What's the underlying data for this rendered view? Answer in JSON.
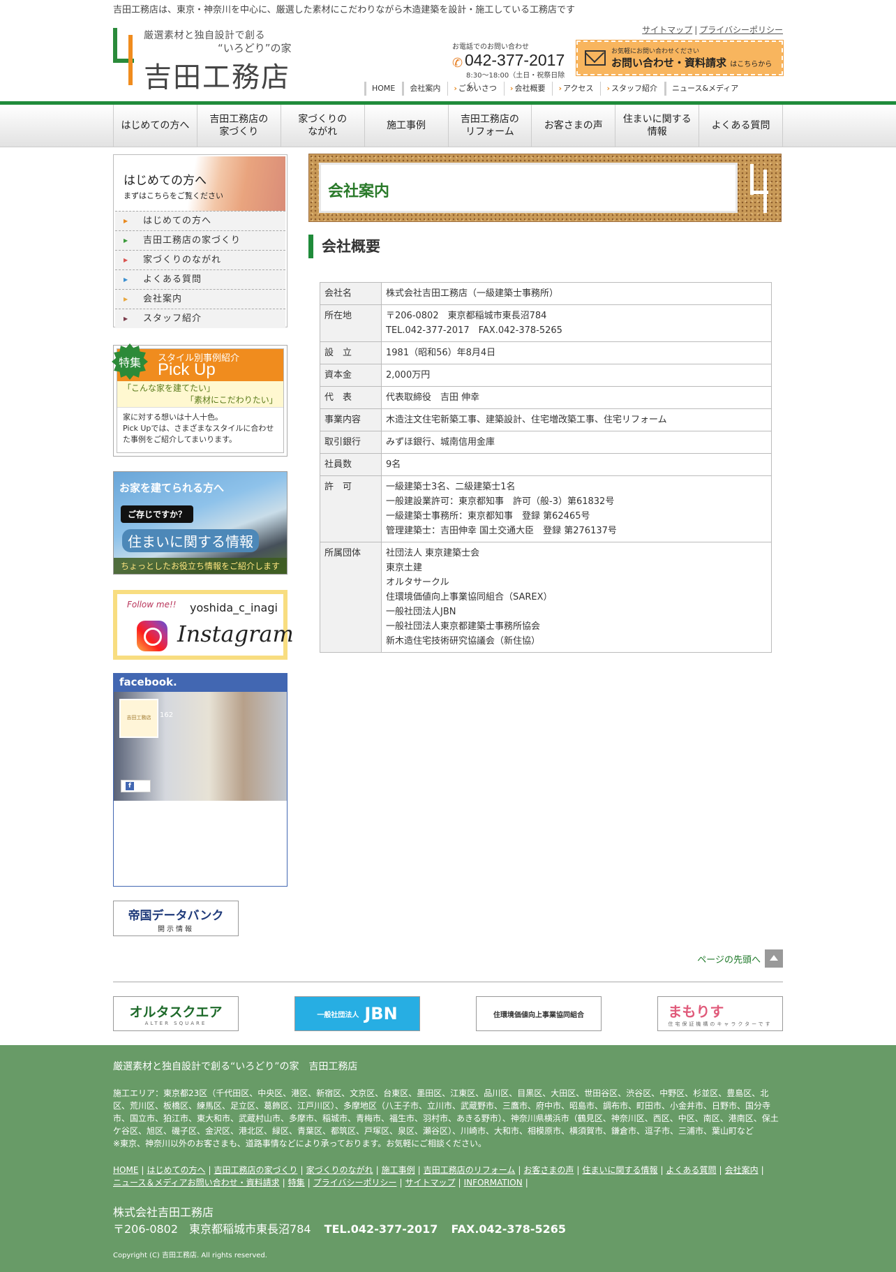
{
  "tagline": "吉田工務店は、東京・神奈川を中心に、厳選した素材にこだわりながら木造建築を設計・施工している工務店です",
  "logo": {
    "sub1": "厳選素材と独自設計で創る",
    "sub2": "“いろどり”の家",
    "name": "吉田工務店"
  },
  "toplinks": [
    "サイトマップ",
    "プライバシーポリシー"
  ],
  "phone": {
    "caption": "お電話でのお問い合わせ",
    "number": "042-377-2017",
    "hours": "8:30〜18:00（土日・祝祭日除く）"
  },
  "contact": {
    "small": "お気軽にお問い合わせください",
    "big": "お問い合わせ・資料請求",
    "suffix": "はこちらから"
  },
  "subnav": [
    "HOME",
    "会社案内",
    "ごあいさつ",
    "会社概要",
    "アクセス",
    "スタッフ紹介",
    "ニュース&メディア"
  ],
  "gnav": [
    "はじめての方へ",
    "吉田工務店の\n家づくり",
    "家づくりの\nながれ",
    "施工事例",
    "吉田工務店の\nリフォーム",
    "お客さまの声",
    "住まいに関する\n情報",
    "よくある質問"
  ],
  "sidebar": {
    "head_title": "はじめての方へ",
    "head_sub": "まずはこちらをご覧ください",
    "items": [
      "はじめての方へ",
      "吉田工務店の家づくり",
      "家づくりのながれ",
      "よくある質問",
      "会社案内",
      "スタッフ紹介"
    ]
  },
  "pickup": {
    "badge": "特集",
    "sub": "スタイル別事例紹介",
    "main": "Pick Up",
    "q1": "「こんな家を建てたい」",
    "q2": "「素材にこだわりたい」",
    "text": "家に対する想いは十人十色。\nPick Upでは、さまざまなスタイルに合わせた事例をご紹介してまいります。"
  },
  "house_banner": {
    "t1": "お家を建てられる方へ",
    "t2": "ご存じですか？",
    "t3": "住まいに関する情報",
    "t4": "ちょっとしたお役立ち情報をご紹介します"
  },
  "instagram": {
    "follow": "Follow me!!",
    "user": "yoshida_c_inagi",
    "word": "Instagram"
  },
  "facebook": {
    "head": "facebook.",
    "thumb": "吉田工務店",
    "count": "162"
  },
  "tdb": {
    "t1": "帝国データバンク",
    "t2": "開示情報"
  },
  "page_title": "会社案内",
  "section_title": "会社概要",
  "company_table": [
    {
      "key": "会社名",
      "lines": [
        "株式会社吉田工務店（一級建築士事務所）"
      ]
    },
    {
      "key": "所在地",
      "lines": [
        "〒206-0802　東京都稲城市東長沼784",
        "TEL.042-377-2017　FAX.042-378-5265"
      ]
    },
    {
      "key": "設　立",
      "lines": [
        "1981（昭和56）年8月4日"
      ]
    },
    {
      "key": "資本金",
      "lines": [
        "2,000万円"
      ]
    },
    {
      "key": "代　表",
      "lines": [
        "代表取締役　吉田 伸幸"
      ]
    },
    {
      "key": "事業内容",
      "lines": [
        "木造注文住宅新築工事、建築設計、住宅増改築工事、住宅リフォーム"
      ]
    },
    {
      "key": "取引銀行",
      "lines": [
        "みずほ銀行、城南信用金庫"
      ]
    },
    {
      "key": "社員数",
      "lines": [
        "9名"
      ]
    },
    {
      "key": "許　可",
      "lines": [
        "一級建築士3名、二級建築士1名",
        "一般建設業許可：東京都知事　許可（般-3）第61832号",
        "一級建築士事務所：東京都知事　登録 第62465号",
        "管理建築士：吉田伸幸 国土交通大臣　登録 第276137号"
      ]
    },
    {
      "key": "所属団体",
      "lines": [
        "社団法人 東京建築士会",
        "東京土建",
        "オルタサークル",
        "住環境価値向上事業協同組合（SAREX）",
        "一般社団法人JBN",
        "一般社団法人東京都建築士事務所協会",
        "新木造住宅技術研究協議会（新住協）"
      ]
    }
  ],
  "pagetop": "ページの先頭へ",
  "partners": {
    "alter": "オルタスクエア",
    "alter_sub": "ALTER SQUARE",
    "jbn_small": "一般社団法人",
    "jbn": "JBN",
    "sarex": "住環境価値向上事業協同組合",
    "mamoris": "まもりす",
    "mamoris_sub": "住宅保証機構のキャラクターです"
  },
  "footer": {
    "title": "厳選素材と独自設計で創る“いろどり”の家　吉田工務店",
    "area": "施工エリア：東京都23区（千代田区、中央区、港区、新宿区、文京区、台東区、墨田区、江東区、品川区、目黒区、大田区、世田谷区、渋谷区、中野区、杉並区、豊島区、北区、荒川区、板橋区、練馬区、足立区、葛飾区、江戸川区）、多摩地区（八王子市、立川市、武蔵野市、三鷹市、府中市、昭島市、調布市、町田市、小金井市、日野市、国分寺市、国立市、狛江市、東大和市、武蔵村山市、多摩市、稲城市、青梅市、福生市、羽村市、あきる野市）、神奈川県横浜市（鶴見区、神奈川区、西区、中区、南区、港南区、保土ケ谷区、旭区、磯子区、金沢区、港北区、緑区、青葉区、都筑区、戸塚区、泉区、瀬谷区）、川崎市、大和市、相模原市、横須賀市、鎌倉市、逗子市、三浦市、葉山町など",
    "note": "※東京、神奈川以外のお客さまも、道路事情などにより承っております。お気軽にご相談ください。",
    "links": [
      "HOME",
      "はじめての方へ",
      "吉田工務店の家づくり",
      "家づくりのながれ",
      "施工事例",
      "吉田工務店のリフォーム",
      "お客さまの声",
      "住まいに関する情報",
      "よくある質問",
      "会社案内",
      "ニュース＆メディア",
      "お問い合わせ・資料請求",
      "特集",
      "プライバシーポリシー",
      "サイトマップ",
      "INFORMATION"
    ],
    "company": "株式会社吉田工務店",
    "address": "〒206-0802　東京都稲城市東長沼784",
    "tel": "TEL.042-377-2017",
    "fax": "FAX.042-378-5265",
    "copyright": "Copyright (C) 吉田工務店. All rights reserved."
  },
  "colors": {
    "brand_green": "#1f8b3a",
    "footer_green": "#689b67",
    "accent_orange": "#f08c1e"
  }
}
